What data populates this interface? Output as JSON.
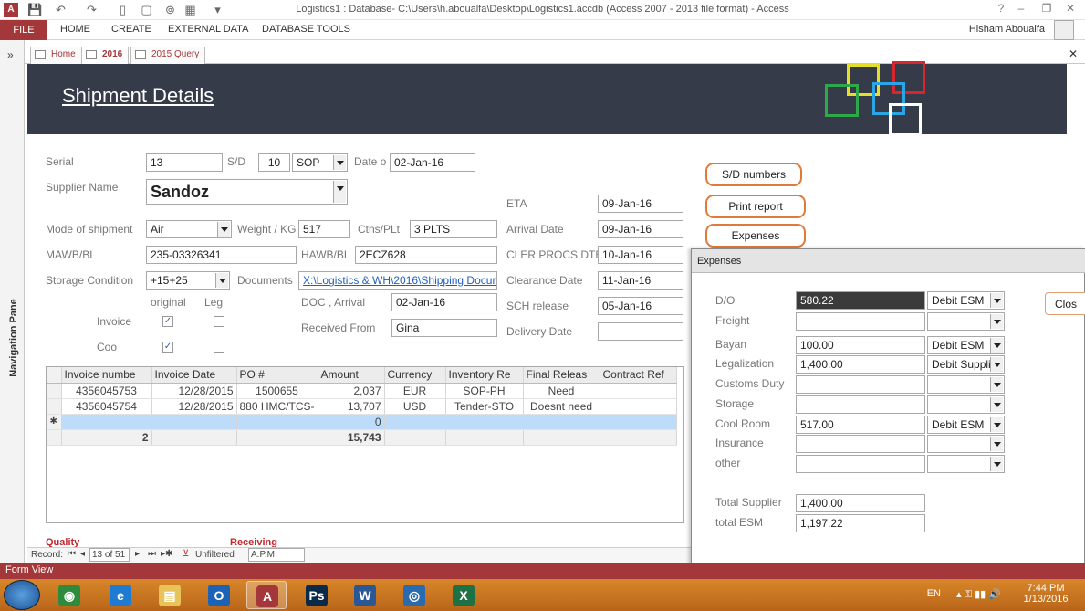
{
  "window": {
    "title": "Logistics1 : Database- C:\\Users\\h.aboualfa\\Desktop\\Logistics1.accdb (Access 2007 - 2013 file format) - Access",
    "app_icon": "A",
    "help": "?",
    "minimize": "–",
    "restore": "❐",
    "close": "✕"
  },
  "ribbon": {
    "file": "FILE",
    "tabs": [
      "HOME",
      "CREATE",
      "EXTERNAL DATA",
      "DATABASE TOOLS"
    ],
    "user": "Hisham Aboualfa"
  },
  "nav_pane": {
    "label": "Navigation Pane",
    "toggle": "»"
  },
  "doc_tabs": [
    {
      "label": "Home"
    },
    {
      "label": "2016"
    },
    {
      "label": "2015 Query"
    }
  ],
  "form": {
    "title": "Shipment Details",
    "serial_label": "Serial",
    "serial": "13",
    "sd_label": "S/D",
    "sd_number": "10",
    "sd_type": "SOP",
    "date_label": "Date o",
    "date": "02-Jan-16",
    "supplier_label": "Supplier Name",
    "supplier": "Sandoz",
    "eta_label": "ETA",
    "eta": "09-Jan-16",
    "mode_label": "Mode of shipment",
    "mode": "Air",
    "weight_label": "Weight / KG",
    "weight": "517",
    "ctns_label": "Ctns/PLt",
    "ctns": "3 PLTS",
    "arrival_label": "Arrival Date",
    "arrival": "09-Jan-16",
    "mawb_label": "MAWB/BL",
    "mawb": "235-03326341",
    "hawb_label": "HAWB/BL",
    "hawb": "2ECZ628",
    "cler_label": "CLER PROCS DTE",
    "cler": "10-Jan-16",
    "storage_label": "Storage Condition",
    "storage": "+15+25",
    "documents_label": "Documents",
    "documents": "X:\\Logistics & WH\\2016\\Shipping Docum",
    "clearance_label": "Clearance Date",
    "clearance": "11-Jan-16",
    "original_label": "original",
    "leg_label": "Leg",
    "doc_arrival_label": "DOC , Arrival",
    "doc_arrival": "02-Jan-16",
    "sch_label": "SCH release",
    "sch": "05-Jan-16",
    "invoice_label": "Invoice",
    "received_label": "Received From",
    "received": "Gina",
    "delivery_label": "Delivery Date",
    "delivery": "",
    "coo_label": "Coo",
    "quality_label": "Quality",
    "receiving_label": "Receiving",
    "buttons": {
      "sd_numbers": "S/D numbers",
      "print_report": "Print report",
      "expenses": "Expenses"
    }
  },
  "grid": {
    "columns": [
      "Invoice numbe",
      "Invoice Date",
      "PO #",
      "Amount",
      "Currency",
      "Inventory Re",
      "Final Releas",
      "Contract Ref"
    ],
    "rows": [
      [
        "4356045753",
        "12/28/2015",
        "1500655",
        "2,037",
        "EUR",
        "SOP-PH",
        "Need",
        ""
      ],
      [
        "4356045754",
        "12/28/2015",
        "880 HMC/TCS-",
        "13,707",
        "USD",
        "Tender-STO",
        "Doesnt need",
        ""
      ]
    ],
    "new_row_marker": "✱",
    "new_row_amount": "0",
    "total_count": "2",
    "total_amount": "15,743"
  },
  "record_nav": {
    "label": "Record:",
    "position": "13 of 51",
    "filter": "Unfiltered",
    "search": "A.P.M"
  },
  "status": "Form View",
  "expenses": {
    "caption": "Expenses",
    "close_button": "Clos",
    "rows": [
      {
        "label": "D/O",
        "amount": "580.22",
        "account": "Debit ESM"
      },
      {
        "label": "Freight",
        "amount": "",
        "account": ""
      },
      {
        "label": "Bayan",
        "amount": "100.00",
        "account": "Debit ESM"
      },
      {
        "label": "Legalization",
        "amount": "1,400.00",
        "account": "Debit Suppli"
      },
      {
        "label": "Customs Duty",
        "amount": "",
        "account": ""
      },
      {
        "label": "Storage",
        "amount": "",
        "account": ""
      },
      {
        "label": "Cool Room",
        "amount": "517.00",
        "account": "Debit ESM"
      },
      {
        "label": "Insurance",
        "amount": "",
        "account": ""
      },
      {
        "label": "other",
        "amount": "",
        "account": ""
      }
    ],
    "total_supplier_label": "Total Supplier",
    "total_supplier": "1,400.00",
    "total_esm_label": "total ESM",
    "total_esm": "1,197.22"
  },
  "taskbar": {
    "apps": [
      {
        "name": "chrome",
        "glyph": "◉",
        "color": "#2e8b3e"
      },
      {
        "name": "ie",
        "glyph": "e",
        "color": "#1f7bd1"
      },
      {
        "name": "explorer",
        "glyph": "▤",
        "color": "#e8c35a"
      },
      {
        "name": "outlook",
        "glyph": "O",
        "color": "#1c63b5"
      },
      {
        "name": "access",
        "glyph": "A",
        "color": "#a4373a"
      },
      {
        "name": "photoshop",
        "glyph": "Ps",
        "color": "#0a2a47"
      },
      {
        "name": "word",
        "glyph": "W",
        "color": "#2b5797"
      },
      {
        "name": "app",
        "glyph": "◎",
        "color": "#2a6ab0"
      },
      {
        "name": "excel",
        "glyph": "X",
        "color": "#1e7145"
      }
    ],
    "lang": "EN",
    "time": "7:44 PM",
    "date": "1/13/2016"
  },
  "colors": {
    "access_red": "#a4373a",
    "header_bg": "#353b48",
    "button_border": "#e07a3a",
    "taskbar": "#c8761f"
  }
}
